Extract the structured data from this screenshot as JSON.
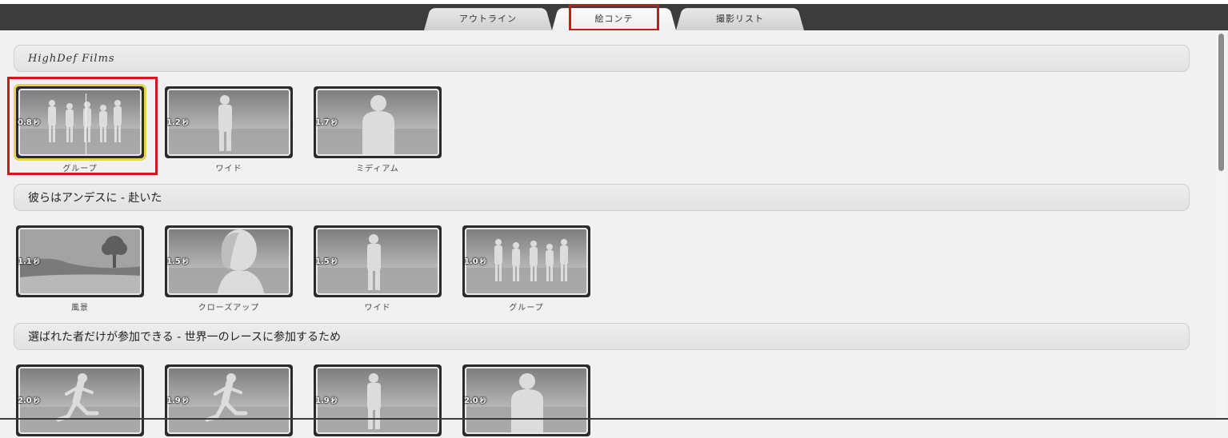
{
  "tabs": [
    {
      "label": "アウトライン"
    },
    {
      "label": "絵コンテ"
    },
    {
      "label": "撮影リスト"
    }
  ],
  "sections": [
    {
      "title": "HighDef Films",
      "clips": [
        {
          "duration": "0.8",
          "unit": "秒",
          "label": "グループ",
          "icon": "group-silhouette"
        },
        {
          "duration": "1.2",
          "unit": "秒",
          "label": "ワイド",
          "icon": "person-full-silhouette"
        },
        {
          "duration": "1.7",
          "unit": "秒",
          "label": "ミディアム",
          "icon": "person-medium-silhouette"
        }
      ]
    },
    {
      "title": "彼らはアンデスに - 赴いた",
      "clips": [
        {
          "duration": "1.1",
          "unit": "秒",
          "label": "風景",
          "icon": "landscape-tree"
        },
        {
          "duration": "1.5",
          "unit": "秒",
          "label": "クローズアップ",
          "icon": "closeup-head"
        },
        {
          "duration": "1.5",
          "unit": "秒",
          "label": "ワイド",
          "icon": "person-full-silhouette"
        },
        {
          "duration": "1.0",
          "unit": "秒",
          "label": "グループ",
          "icon": "group-silhouette"
        }
      ]
    },
    {
      "title": "選ばれた者だけが参加できる - 世界一のレースに参加するため",
      "clips": [
        {
          "duration": "2.0",
          "unit": "秒",
          "icon": "runner-silhouette"
        },
        {
          "duration": "1.9",
          "unit": "秒",
          "icon": "runner-silhouette"
        },
        {
          "duration": "1.9",
          "unit": "秒",
          "icon": "person-full-silhouette"
        },
        {
          "duration": "2.0",
          "unit": "秒",
          "icon": "person-medium-silhouette"
        }
      ]
    }
  ]
}
